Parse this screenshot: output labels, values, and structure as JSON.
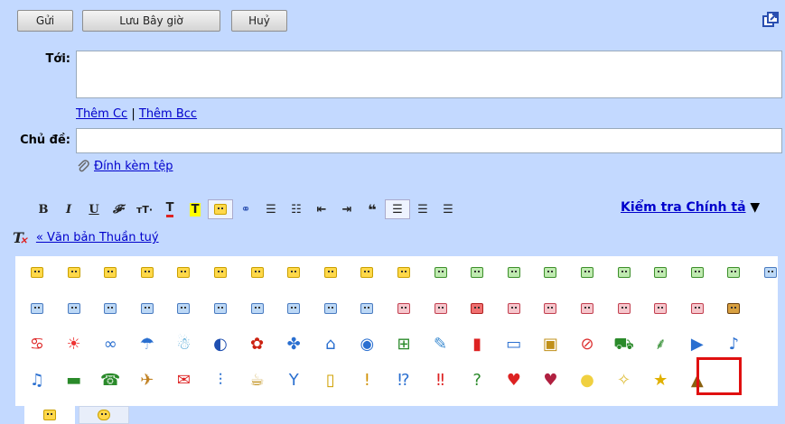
{
  "toolbar": {
    "send": "Gửi",
    "save_now": "Lưu Bây giờ",
    "cancel": "Huỷ"
  },
  "compose": {
    "to_label": "Tới:",
    "add_cc": "Thêm Cc",
    "separator": "|",
    "add_bcc": "Thêm Bcc",
    "subject_label": "Chủ đề:",
    "attach": "Đính kèm tệp",
    "to_value": "",
    "subject_value": ""
  },
  "format": {
    "spellcheck": "Kiểm tra Chính tả",
    "spellcheck_arrow": "▼",
    "plain_text": "« Văn bản Thuần tuý"
  },
  "emoticons": {
    "rows": [
      [
        "smiley-yellow",
        "smiley-yellow",
        "smiley-yellow",
        "smiley-yellow",
        "smiley-yellow",
        "smiley-yellow",
        "smiley-yellow",
        "smiley-yellow",
        "smiley-yellow",
        "smiley-yellow",
        "smiley-yellow",
        "smiley-green",
        "smiley-green",
        "smiley-green",
        "smiley-green",
        "smiley-green",
        "smiley-green",
        "smiley-green",
        "smiley-green",
        "smiley-green",
        "smiley-blue"
      ],
      [
        "smiley-blue",
        "smiley-blue",
        "smiley-blue",
        "smiley-blue",
        "smiley-blue",
        "smiley-blue",
        "smiley-blue",
        "smiley-blue",
        "smiley-blue",
        "smiley-blue",
        "smiley-pink",
        "smiley-pink",
        "smiley-red",
        "smiley-pink",
        "smiley-pink",
        "smiley-pink",
        "smiley-pink",
        "smiley-pink",
        "smiley-pink",
        "smiley-brown"
      ],
      [
        "crab-icon",
        "sun-icon",
        "link-icon",
        "umbrella-icon",
        "snowman-icon",
        "moon-icon",
        "rose-icon",
        "flower-icon",
        "house-icon",
        "camera-icon",
        "gift-icon",
        "tool-icon",
        "phone-icon",
        "computer-icon",
        "bag-icon",
        "ball-icon",
        "car-icon",
        "plant-icon",
        "video-camera-icon",
        "music-note-icon"
      ],
      [
        "music-notes-icon",
        "tv-icon",
        "phone-green-icon",
        "bird-icon",
        "envelope-icon",
        "fork-knife-icon",
        "coffee-icon",
        "cocktail-icon",
        "beer-icon",
        "exclamation-icon",
        "question-exclamation-icon",
        "double-exclamation-icon",
        "question-icon",
        "heart-icon",
        "broken-heart-icon",
        "lightbulb-icon",
        "sparkle-icon",
        "star-icon",
        "poo-icon"
      ]
    ],
    "selected": "poo-icon"
  },
  "colors": {
    "accent": "#c3d9ff",
    "link": "#0000cc",
    "selection": "#e01010"
  }
}
